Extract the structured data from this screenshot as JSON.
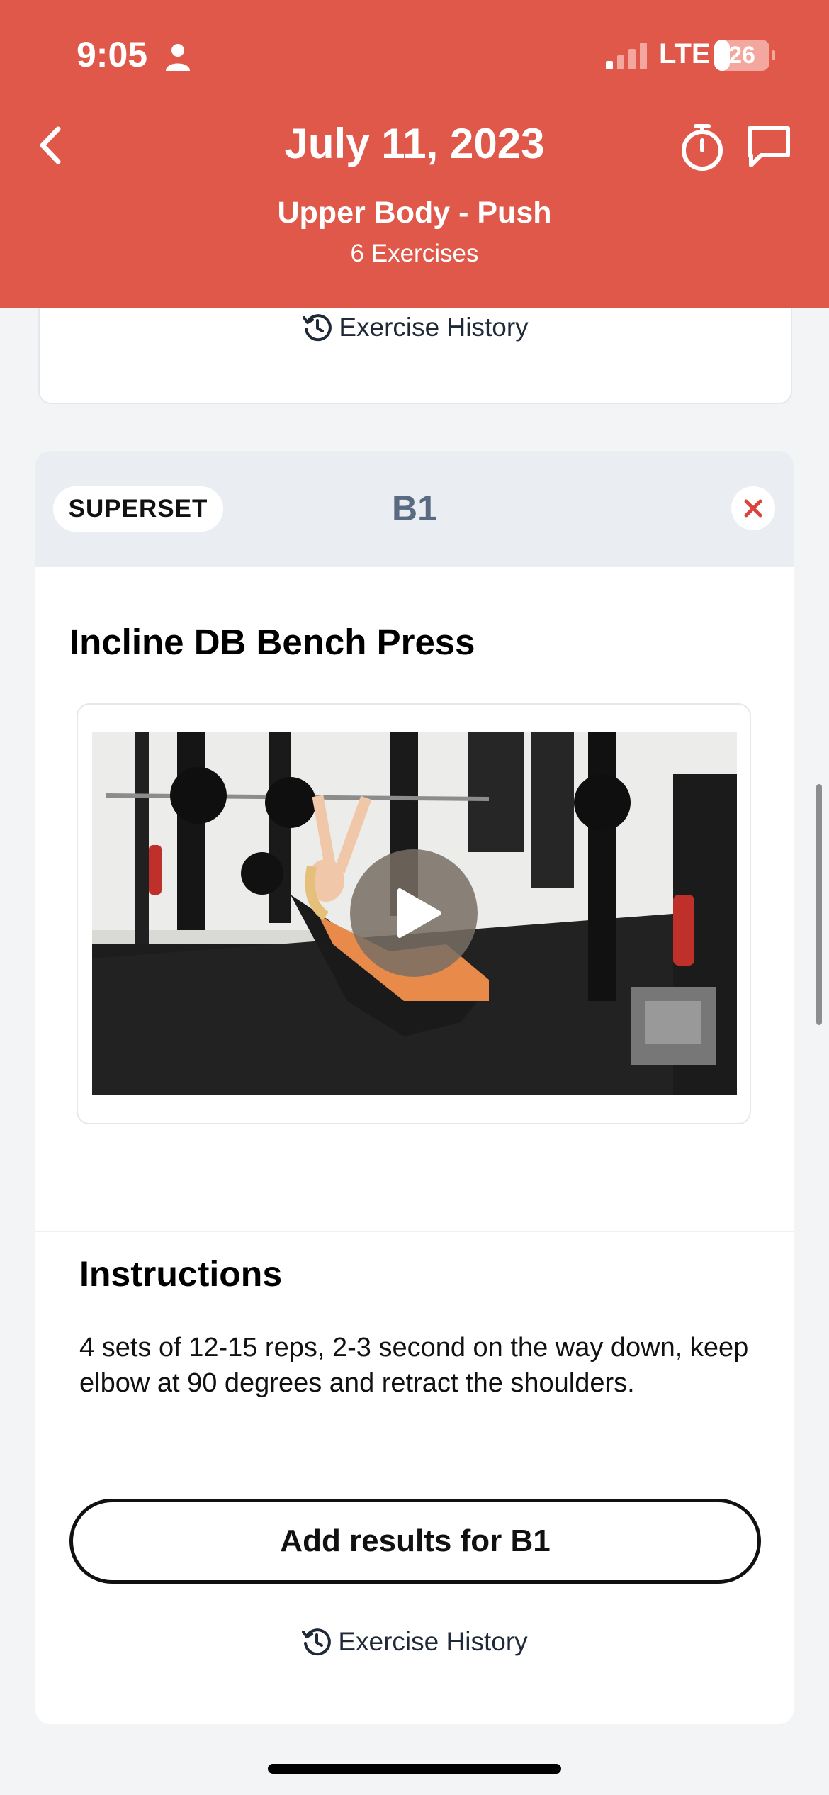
{
  "status_bar": {
    "time": "9:05",
    "network": "LTE",
    "battery": "26"
  },
  "header": {
    "date_title": "July 11, 2023",
    "workout_name": "Upper Body - Push",
    "exercise_count": "6 Exercises",
    "background_color": "#e0584a"
  },
  "previous_card": {
    "history_label": "Exercise History"
  },
  "superset": {
    "badge_label": "SUPERSET",
    "group_label": "B1",
    "exercise": {
      "title": "Incline DB Bench Press",
      "video": {
        "play_icon": "play-icon"
      },
      "instructions_title": "Instructions",
      "instructions_text": "4 sets of 12-15 reps, 2-3 second on the way down, keep elbow at 90 degrees and retract the shoulders.",
      "add_results_label": "Add results for B1",
      "history_label": "Exercise History"
    }
  },
  "icons": {
    "back": "chevron-left-icon",
    "timer": "stopwatch-icon",
    "chat": "chat-bubble-icon",
    "history": "history-clock-icon",
    "remove": "close-icon"
  }
}
